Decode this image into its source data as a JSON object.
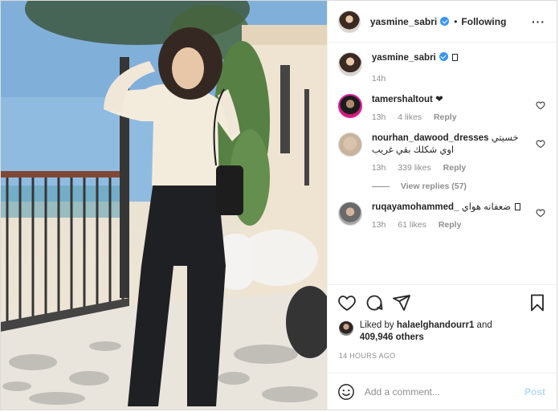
{
  "post": {
    "author": "yasmine_sabri",
    "follow_state": "Following",
    "dot": "•",
    "more": "···"
  },
  "caption": {
    "user": "yasmine_sabri",
    "time": "14h"
  },
  "comments": [
    {
      "user": "tamershaltout",
      "text": "❤",
      "time": "13h",
      "likes": "4 likes",
      "reply": "Reply"
    },
    {
      "user": "nourhan_dawood_dresses",
      "text": "خسيتي اوي شكلك بقي غريب",
      "time": "13h",
      "likes": "339 likes",
      "reply": "Reply"
    },
    {
      "user": "ruqayamohammed_",
      "text": "ضعفانه هواي",
      "time": "13h",
      "likes": "61 likes",
      "reply": "Reply"
    }
  ],
  "view_replies": "View replies (57)",
  "likes": {
    "prefix": "Liked by ",
    "liker": "halaelghandourr1",
    "connector": " and",
    "others": "409,946 others"
  },
  "timestamp": "14 HOURS AGO",
  "add_comment": {
    "placeholder": "Add a comment...",
    "post_label": "Post"
  },
  "icons": {
    "like": "heart-icon",
    "comment": "comment-icon",
    "share": "paper-plane-icon",
    "save": "bookmark-icon",
    "emoji": "smiley-icon",
    "more": "more-options-icon"
  },
  "colors": {
    "verified": "#3897f0",
    "post_disabled": "#b3dbff",
    "muted": "#8e8e8e"
  }
}
